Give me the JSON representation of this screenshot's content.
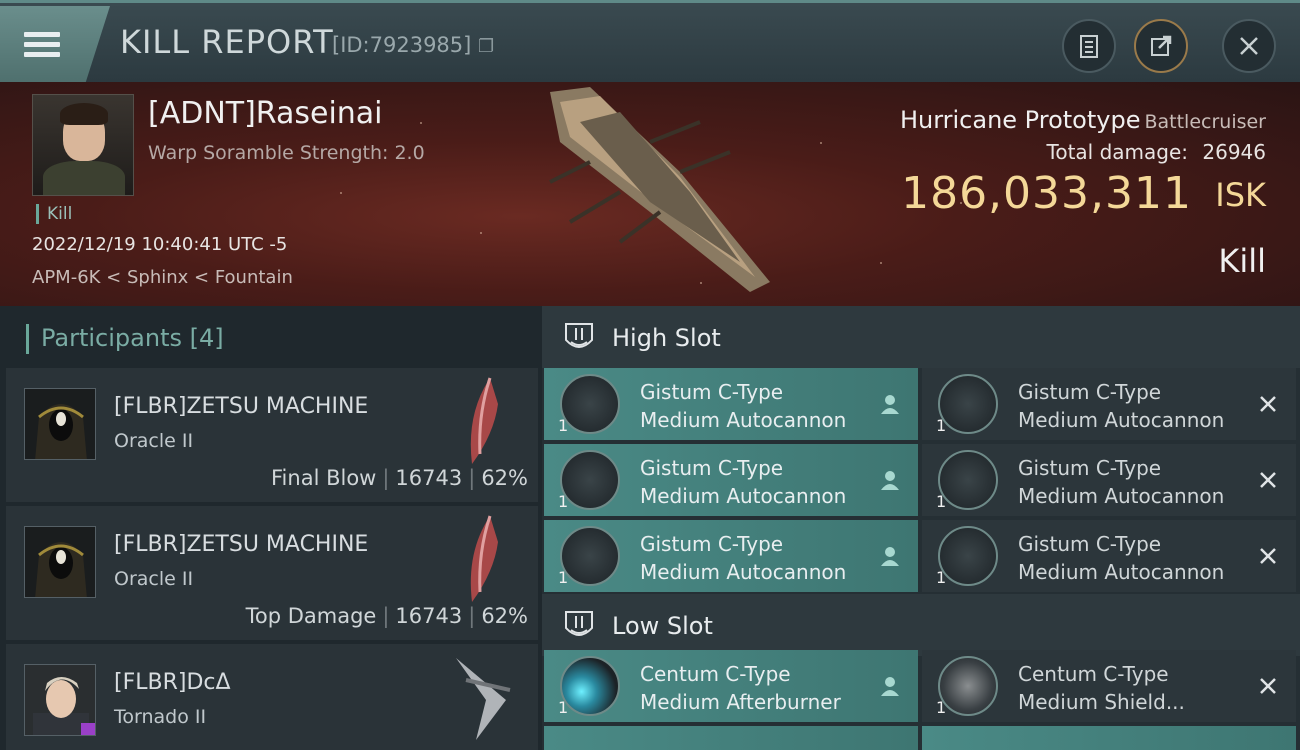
{
  "header": {
    "title": "KILL REPORT",
    "id_text": "[ID:7923985]"
  },
  "victim": {
    "name": "[ADNT]Raseinai",
    "warp": "Warp Soramble Strength: 2.0",
    "tag": "Kill",
    "datetime": "2022/12/19 10:40:41 UTC -5",
    "location": "APM-6K < Sphinx < Fountain"
  },
  "ship": {
    "name": "Hurricane Prototype",
    "class": "Battlecruiser",
    "total_damage_label": "Total damage:",
    "total_damage": "26946",
    "isk_value": "186,033,311",
    "isk_unit": "ISK",
    "result": "Kill"
  },
  "participants": {
    "label": "Participants",
    "count": "[4]",
    "rows": [
      {
        "name": "[FLBR]ZETSU MACHINE",
        "ship": "Oracle II",
        "role": "Final Blow",
        "damage": "16743",
        "percent": "62%"
      },
      {
        "name": "[FLBR]ZETSU MACHINE",
        "ship": "Oracle II",
        "role": "Top Damage",
        "damage": "16743",
        "percent": "62%"
      },
      {
        "name": "[FLBR]DcΔ",
        "ship": "Tornado II"
      }
    ]
  },
  "slots": {
    "high": {
      "label": "High Slot",
      "modules": [
        {
          "qty": "1",
          "line1": "Gistum C-Type",
          "line2": "Medium Autocannon",
          "status": "destroyed"
        },
        {
          "qty": "1",
          "line1": "Gistum C-Type",
          "line2": "Medium Autocannon",
          "status": "dropped"
        },
        {
          "qty": "1",
          "line1": "Gistum C-Type",
          "line2": "Medium Autocannon",
          "status": "destroyed"
        },
        {
          "qty": "1",
          "line1": "Gistum C-Type",
          "line2": "Medium Autocannon",
          "status": "dropped"
        },
        {
          "qty": "1",
          "line1": "Gistum C-Type",
          "line2": "Medium Autocannon",
          "status": "destroyed"
        },
        {
          "qty": "1",
          "line1": "Gistum C-Type",
          "line2": "Medium Autocannon",
          "status": "dropped"
        }
      ]
    },
    "low": {
      "label": "Low Slot",
      "modules": [
        {
          "qty": "1",
          "line1": "Centum C-Type",
          "line2": "Medium Afterburner",
          "status": "destroyed"
        },
        {
          "qty": "1",
          "line1": "Centum C-Type",
          "line2": "Medium Shield...",
          "status": "dropped"
        }
      ]
    }
  },
  "colors": {
    "accent": "#6aa89a",
    "isk": "#f4d898",
    "destroyed_bg": "#4a8a86",
    "dropped_bg": "#2c363b"
  },
  "icons": [
    "menu-icon",
    "clipboard-icon",
    "export-icon",
    "close-icon",
    "copy-icon",
    "turret-icon",
    "pilot-icon",
    "x-icon"
  ]
}
